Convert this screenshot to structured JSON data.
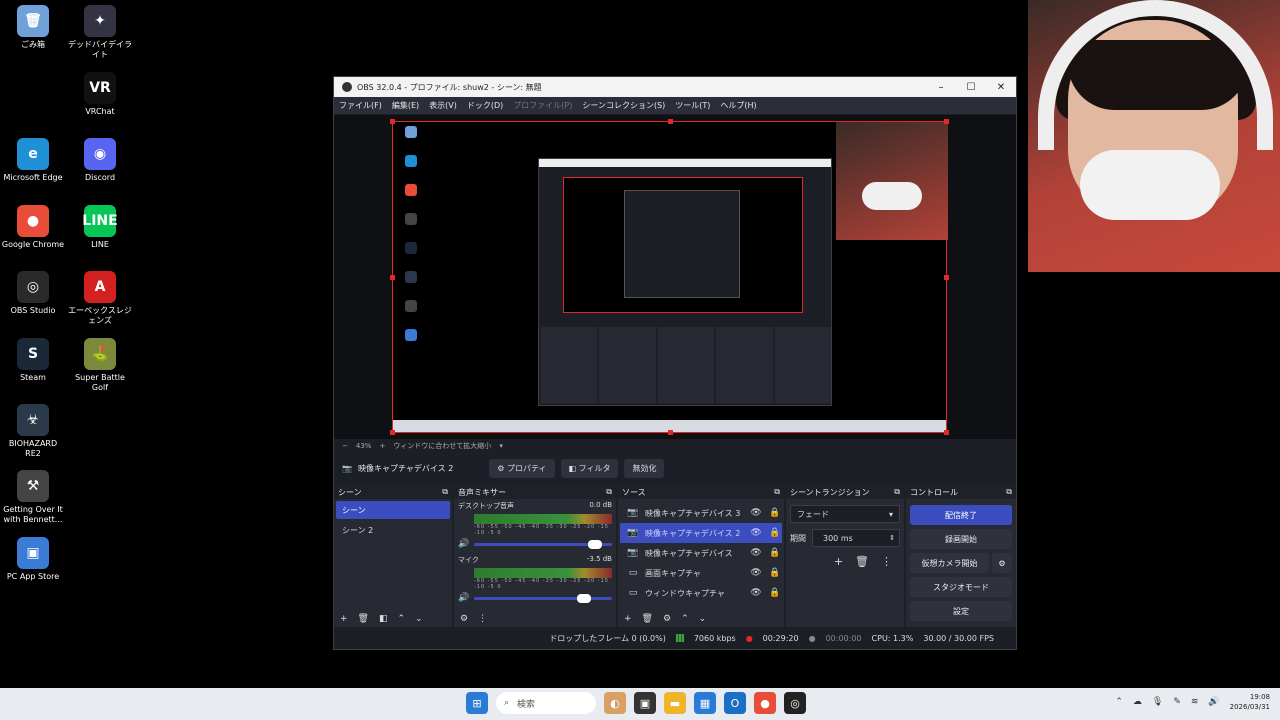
{
  "desktop": {
    "icons": [
      {
        "label": "ごみ箱",
        "glyph": "🗑",
        "color": "#6fa0d8"
      },
      {
        "label": "デッドバイデイライト",
        "glyph": "✦",
        "color": "#334"
      },
      {
        "label": "VRChat",
        "glyph": "VR",
        "color": "#111"
      },
      {
        "label": "Microsoft Edge",
        "glyph": "e",
        "color": "#1f8fd6"
      },
      {
        "label": "Discord",
        "glyph": "◉",
        "color": "#5865f2"
      },
      {
        "label": "Google Chrome",
        "glyph": "●",
        "color": "#e84d3a"
      },
      {
        "label": "LINE",
        "glyph": "LINE",
        "color": "#06c755"
      },
      {
        "label": "OBS Studio",
        "glyph": "◎",
        "color": "#2a2a2a"
      },
      {
        "label": "エーペックスレジェンズ",
        "glyph": "A",
        "color": "#d32020"
      },
      {
        "label": "Steam",
        "glyph": "S",
        "color": "#1b2838"
      },
      {
        "label": "Super Battle Golf",
        "glyph": "⛳",
        "color": "#7a8a3a"
      },
      {
        "label": "BIOHAZARD RE2",
        "glyph": "☣",
        "color": "#2a3a4a"
      },
      {
        "label": "Getting Over It with Bennett...",
        "glyph": "⚒",
        "color": "#444"
      },
      {
        "label": "PC App Store",
        "glyph": "▣",
        "color": "#3a7bd5"
      }
    ]
  },
  "obs": {
    "title": "OBS 32.0.4 - プロファイル: shuw2 - シーン: 無題",
    "menu": [
      "ファイル(F)",
      "編集(E)",
      "表示(V)",
      "ドック(D)",
      "プロファイル(P)",
      "シーンコレクション(S)",
      "ツール(T)",
      "ヘルプ(H)"
    ],
    "zoom": {
      "percent": "43%",
      "fit_label": "ウィンドウに合わせて拡大縮小"
    },
    "source_toolbar": {
      "selected_source": "映像キャプチャデバイス 2",
      "properties": "プロパティ",
      "filters": "フィルタ",
      "disable": "無効化"
    },
    "scenes": {
      "header": "シーン",
      "items": [
        "シーン",
        "シーン 2"
      ]
    },
    "mixer": {
      "header": "音声ミキサー",
      "channels": [
        {
          "name": "デスクトップ音声",
          "db": "0.0 dB",
          "level": 0.88
        },
        {
          "name": "マイク",
          "db": "-3.5 dB",
          "level": 0.8
        }
      ],
      "scale": "-60 -55 -50 -45 -40 -35 -30 -25 -20 -15 -10 -5 0"
    },
    "sources": {
      "header": "ソース",
      "items": [
        {
          "name": "映像キャプチャデバイス 3",
          "icon": "📷"
        },
        {
          "name": "映像キャプチャデバイス 2",
          "icon": "📷"
        },
        {
          "name": "映像キャプチャデバイス",
          "icon": "📷"
        },
        {
          "name": "画面キャプチャ",
          "icon": "▭"
        },
        {
          "name": "ウィンドウキャプチャ",
          "icon": "▭"
        }
      ]
    },
    "transitions": {
      "header": "シーントランジション",
      "selected": "フェード",
      "duration_label": "期間",
      "duration": "300 ms"
    },
    "controls": {
      "header": "コントロール",
      "stop_stream": "配信終了",
      "start_record": "録画開始",
      "virtual_cam": "仮想カメラ開始",
      "studio_mode": "スタジオモード",
      "settings": "設定"
    },
    "status": {
      "dropped": "ドロップしたフレーム 0 (0.0%)",
      "bitrate": "7060 kbps",
      "stream_time": "00:29:20",
      "record_time": "00:00:00",
      "cpu": "CPU: 1.3%",
      "fps": "30.00 / 30.00 FPS"
    }
  },
  "taskbar": {
    "search": "検索",
    "time": "19:08",
    "date": "2026/03/31"
  }
}
